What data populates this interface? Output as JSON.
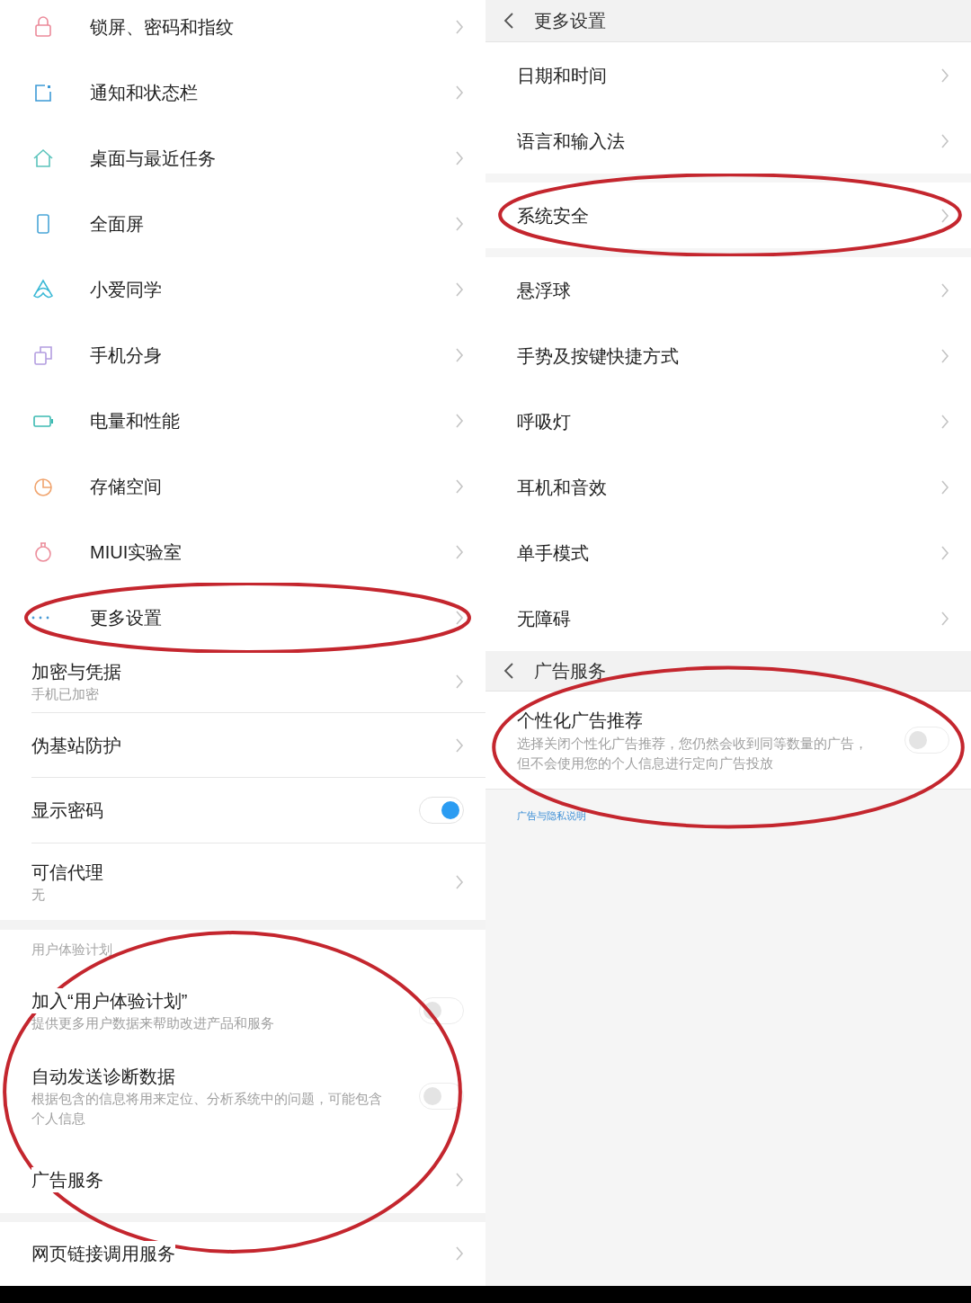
{
  "main_settings": [
    {
      "label": "锁屏、密码和指纹",
      "circled": false
    },
    {
      "label": "通知和状态栏",
      "circled": false
    },
    {
      "label": "桌面与最近任务",
      "circled": false
    },
    {
      "label": "全面屏",
      "circled": false
    },
    {
      "label": "小爱同学",
      "circled": false
    },
    {
      "label": "手机分身",
      "circled": false
    },
    {
      "label": "电量和性能",
      "circled": false
    },
    {
      "label": "存储空间",
      "circled": false
    },
    {
      "label": "MIUI实验室",
      "circled": false
    },
    {
      "label": "更多设置",
      "circled": true
    }
  ],
  "security": [
    {
      "kind": "link",
      "title": "加密与凭据",
      "subtitle": "手机已加密"
    },
    {
      "kind": "link",
      "title": "伪基站防护"
    },
    {
      "kind": "toggle",
      "title": "显示密码",
      "on": true
    },
    {
      "kind": "link",
      "title": "可信代理",
      "subtitle": "无"
    }
  ],
  "user_experience": {
    "header": "用户体验计划",
    "circled": true,
    "items": [
      {
        "kind": "toggle",
        "title": "加入“用户体验计划”",
        "subtitle": "提供更多用户数据来帮助改进产品和服务",
        "on": false
      },
      {
        "kind": "toggle",
        "title": "自动发送诊断数据",
        "subtitle": "根据包含的信息将用来定位、分析系统中的问题，可能包含个人信息",
        "on": false
      },
      {
        "kind": "link",
        "title": "广告服务"
      }
    ]
  },
  "web_links": {
    "title": "网页链接调用服务"
  },
  "more_settings": {
    "title": "更多设置",
    "groups": [
      [
        {
          "label": "日期和时间",
          "circled": false
        },
        {
          "label": "语言和输入法",
          "circled": false
        }
      ],
      [
        {
          "label": "系统安全",
          "circled": true
        }
      ],
      [
        {
          "label": "悬浮球",
          "circled": false
        },
        {
          "label": "手势及按键快捷方式",
          "circled": false
        },
        {
          "label": "呼吸灯",
          "circled": false
        },
        {
          "label": "耳机和音效",
          "circled": false
        },
        {
          "label": "单手模式",
          "circled": false
        },
        {
          "label": "无障碍",
          "circled": false
        }
      ]
    ]
  },
  "ad_service": {
    "title": "广告服务",
    "item": {
      "title": "个性化广告推荐",
      "subtitle": "选择关闭个性化广告推荐，您仍然会收到同等数量的广告，但不会使用您的个人信息进行定向广告投放",
      "on": false,
      "circled": true
    },
    "link": "广告与隐私说明"
  }
}
